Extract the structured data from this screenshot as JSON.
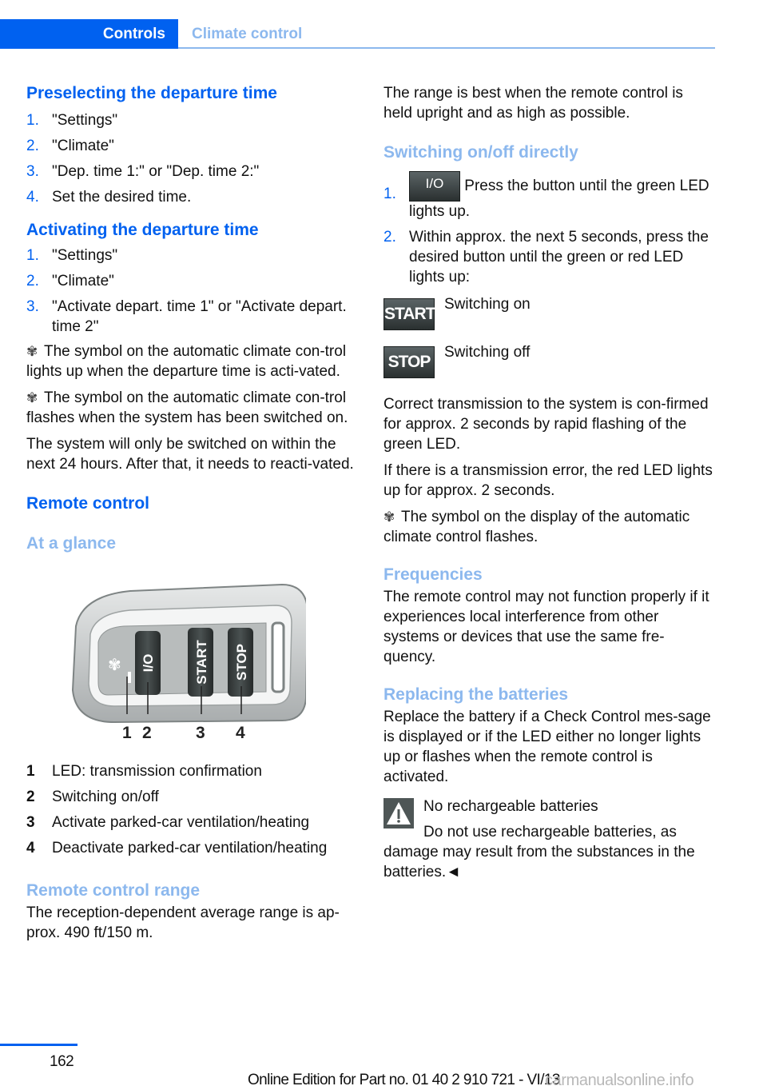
{
  "header": {
    "chapter": "Controls",
    "section": "Climate control"
  },
  "left": {
    "preselect": {
      "title": "Preselecting the departure time",
      "steps": [
        "\"Settings\"",
        "\"Climate\"",
        "\"Dep. time 1:\" or \"Dep. time 2:\"",
        "Set the desired time."
      ]
    },
    "activate": {
      "title": "Activating the departure time",
      "steps": [
        "\"Settings\"",
        "\"Climate\"",
        "\"Activate depart. time 1\" or \"Activate depart. time 2\""
      ],
      "note1": "The symbol on the automatic climate con-trol lights up when the departure time is acti-vated.",
      "note2": "The symbol on the automatic climate con-trol flashes when the system has been switched on.",
      "note3": "The system will only be switched on within the next 24 hours. After that, it needs to reacti-vated."
    },
    "remote": {
      "title": "Remote control",
      "subtitle": "At a glance",
      "figure": {
        "buttons": [
          "I/O",
          "START",
          "STOP"
        ],
        "callouts": [
          "1",
          "2",
          "3",
          "4"
        ]
      },
      "legend": [
        {
          "num": "1",
          "text": "LED: transmission confirmation"
        },
        {
          "num": "2",
          "text": "Switching on/off"
        },
        {
          "num": "3",
          "text": "Activate parked-car ventilation/heating"
        },
        {
          "num": "4",
          "text": "Deactivate parked-car ventilation/heating"
        }
      ]
    },
    "range": {
      "title": "Remote control range",
      "text": "The reception-dependent average range is ap-prox. 490 ft/150 m."
    }
  },
  "right": {
    "range_note": "The range is best when the remote control is held upright and as high as possible.",
    "switching": {
      "title": "Switching on/off directly",
      "step1_button": "I/O",
      "step1": "Press the button until the green LED lights up.",
      "step2": "Within approx. the next 5 seconds, press the desired button until the green or red LED lights up:",
      "start_button": "START",
      "start_label": "Switching on",
      "stop_button": "STOP",
      "stop_label": "Switching off",
      "confirm": "Correct transmission to the system is con-firmed for approx. 2 seconds by rapid flashing of the green LED.",
      "error": "If there is a transmission error, the red LED lights up for approx. 2 seconds.",
      "display_note": "The symbol on the display of the automatic climate control flashes."
    },
    "frequencies": {
      "title": "Frequencies",
      "text": "The remote control may not function properly if it experiences local interference from other systems or devices that use the same fre-quency."
    },
    "batteries": {
      "title": "Replacing the batteries",
      "text": "Replace the battery if a Check Control mes-sage is displayed or if the LED either no longer lights up or flashes when the remote control is activated.",
      "warning_title": "No rechargeable batteries",
      "warning_text": "Do not use rechargeable batteries, as damage may result from the substances in the batteries.◄"
    }
  },
  "footer": {
    "page": "162",
    "edition": "Online Edition for Part no. 01 40 2 910 721 - VI/13",
    "watermark": "carmanualsonline.info"
  },
  "colors": {
    "accent": "#0061f0",
    "accent_light": "#8cb8ee"
  }
}
